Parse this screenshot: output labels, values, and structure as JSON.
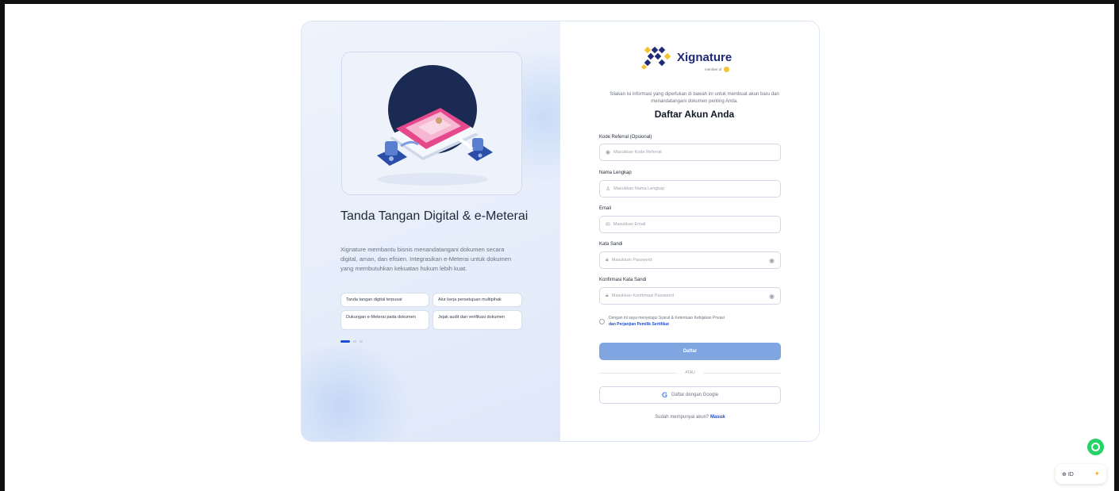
{
  "hero": {
    "title": "Tanda Tangan Digital & e-Meterai",
    "description": "Xignature membantu bisnis menandatangani dokumen secara digital, aman, dan efisien. Integrasikan e-Meterai untuk dokumen yang membutuhkan kekuatan hukum lebih kuat.",
    "chips": [
      "Tanda tangan digital terpusat",
      "Alur kerja persetujuan multipihak",
      "Dukungan e-Meterai pada dokumen",
      "Jejak audit dan verifikasi dokumen"
    ]
  },
  "brand": {
    "name": "Xignature",
    "member_of": "member of",
    "primary_color": "#1e2a78",
    "accent_color": "#f2c433"
  },
  "form": {
    "intro": "Silakan isi informasi yang diperlukan di bawah ini untuk membuat akun baru dan menandatangani dokumen penting Anda.",
    "title": "Daftar Akun Anda",
    "referral_label": "Kode Referral (Opsional)",
    "referral_placeholder": "Masukkan Kode Referral",
    "name_label": "Nama Lengkap",
    "name_placeholder": "Masukkan Nama Lengkap",
    "email_label": "Email",
    "email_placeholder": "Masukkan Email",
    "password_label": "Kata Sandi",
    "password_placeholder": "Masukkan Password",
    "confirm_label": "Konfirmasi Kata Sandi",
    "confirm_placeholder": "Masukkan Konfirmasi Password",
    "consent_text": "Dengan ini saya menyetujui Syarat & Ketentuan Kebijakan Privasi",
    "consent_link": "dan Perjanjian Pemilik Sertifikat",
    "submit_label": "Daftar",
    "divider_label": "ATAU",
    "google_label": "Daftar dengan Google",
    "login_prompt": "Sudah mempunyai akun?",
    "login_link": "Masuk",
    "button_color": "#7fa6e0"
  },
  "widget": {
    "lang_label": "ID"
  }
}
